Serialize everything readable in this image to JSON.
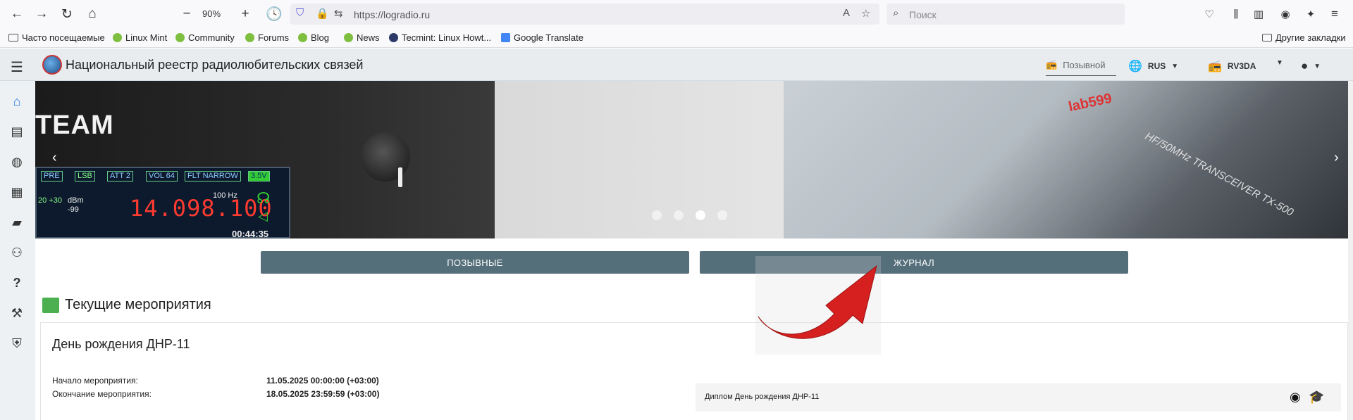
{
  "browser": {
    "zoom": "90%",
    "url": "https://logradio.ru",
    "search_placeholder": "Поиск"
  },
  "bookmarks": [
    {
      "label": "Часто посещаемые"
    },
    {
      "label": "Linux Mint"
    },
    {
      "label": "Community"
    },
    {
      "label": "Forums"
    },
    {
      "label": "Blog"
    },
    {
      "label": "News"
    },
    {
      "label": "Tecmint: Linux Howt..."
    },
    {
      "label": "Google Translate"
    }
  ],
  "other_bookmarks": "Другие закладки",
  "site": {
    "title": "Национальный реестр радиолюбительских связей",
    "callsign_placeholder": "Позывной",
    "language": "RUS",
    "station": "RV3DA"
  },
  "banner": {
    "team_text": "TEAM",
    "lcd_tags": [
      "PRE",
      "LSB",
      "ATT 2",
      "VOL 64",
      "FLT NARROW"
    ],
    "battery": "3.5V",
    "db_scale": "20 +30",
    "dbm_label": "dBm",
    "dbm_value": "-99",
    "frequency": "14.098.100",
    "freq_unit": "100 Hz",
    "time": "00:44:35",
    "transceiver_label": "HF/50MHz TRANSCEIVER TX-500",
    "brand": "lab599",
    "slide_count": 4,
    "active_slide": 3
  },
  "actions": {
    "callsigns": "ПОЗЫВНЫЕ",
    "journal": "ЖУРНАЛ"
  },
  "events": {
    "section_title": "Текущие мероприятия",
    "event": {
      "name": "День рождения ДНР-11",
      "start_label": "Начало мероприятия:",
      "start_value": "11.05.2025 00:00:00 (+03:00)",
      "end_label": "Окончание мероприятия:",
      "end_value": "18.05.2025 23:59:59 (+03:00)",
      "diploma": "Диплом День рождения ДНР-11"
    }
  },
  "colors": {
    "accent": "#1a73e8",
    "button": "#546e7a",
    "header_bg": "#e8ecef",
    "arrow": "#d62020"
  }
}
